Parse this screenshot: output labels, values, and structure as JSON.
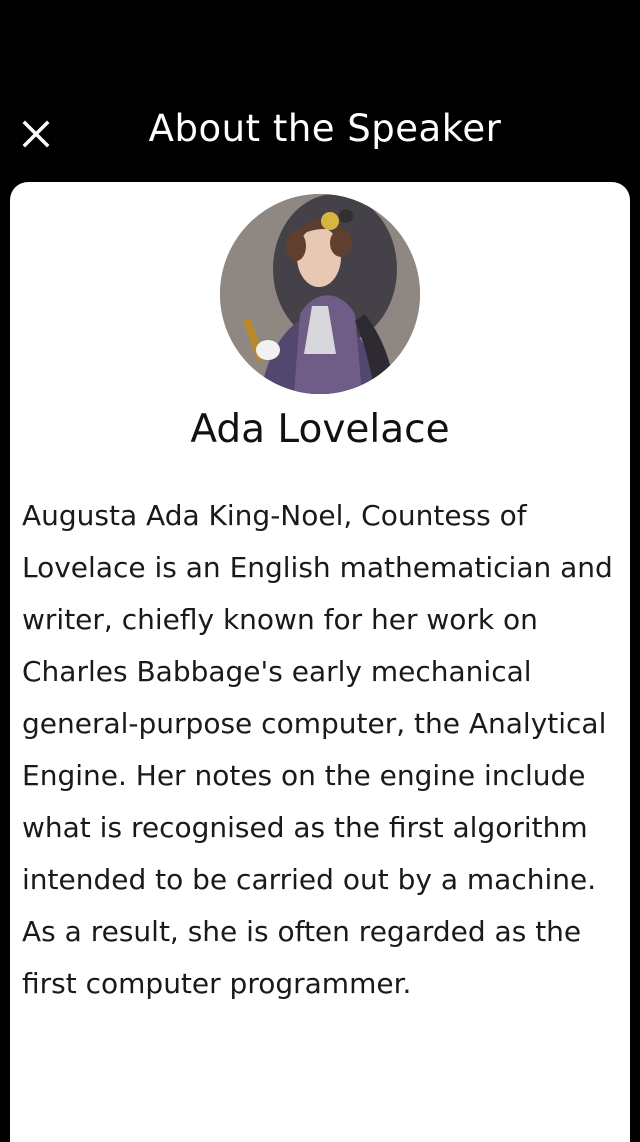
{
  "header": {
    "title": "About the Speaker",
    "close_icon": "close-icon"
  },
  "speaker": {
    "name": "Ada Lovelace",
    "avatar_icon": "speaker-portrait",
    "bio": "Augusta Ada King-Noel, Countess of Lovelace is an English mathematician and writer, chiefly known for her work on Charles Babbage's early mechanical general-purpose computer, the Analytical Engine. Her notes on the engine include what is recognised as the first algorithm intended to be carried out by a machine. As a result, she is often regarded as the first computer programmer."
  },
  "colors": {
    "background": "#000000",
    "card": "#ffffff",
    "header_text": "#ffffff",
    "body_text": "#1a1a1a"
  }
}
